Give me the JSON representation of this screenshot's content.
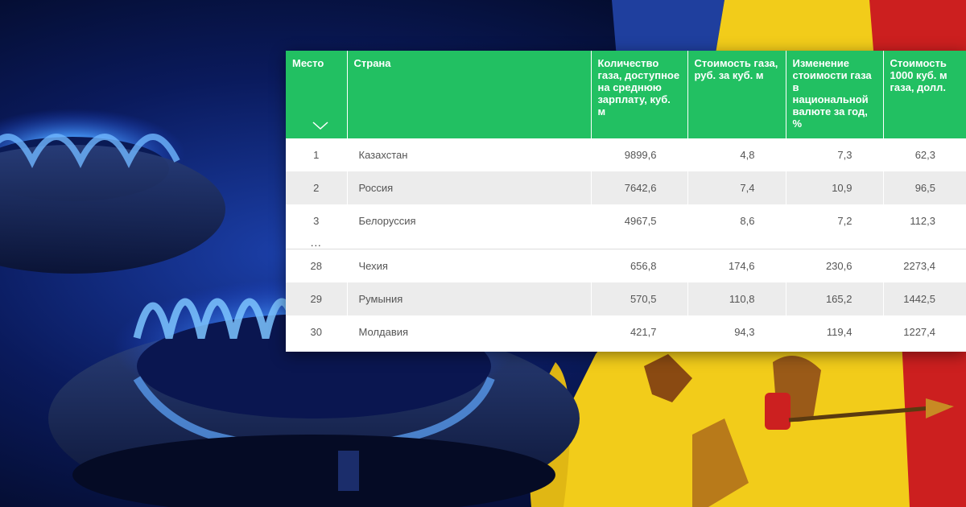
{
  "table": {
    "headers": [
      "Место",
      "Страна",
      "Количество газа, доступное на среднюю зарплату, куб. м",
      "Стоимость газа, руб. за куб. м",
      "Изменение стоимости газа в национальной валюте за год, %",
      "Стоимость 1000 куб. м газа, долл."
    ],
    "sort_icon": "chevron-down-icon",
    "rows_top": [
      {
        "rank": "1",
        "country": "Казахстан",
        "gas": "9899,6",
        "price": "4,8",
        "change": "7,3",
        "usd": "62,3"
      },
      {
        "rank": "2",
        "country": "Россия",
        "gas": "7642,6",
        "price": "7,4",
        "change": "10,9",
        "usd": "96,5"
      },
      {
        "rank": "3",
        "country": "Белоруссия",
        "gas": "4967,5",
        "price": "8,6",
        "change": "7,2",
        "usd": "112,3"
      }
    ],
    "ellipsis": "...",
    "rows_bottom": [
      {
        "rank": "28",
        "country": "Чехия",
        "gas": "656,8",
        "price": "174,6",
        "change": "230,6",
        "usd": "2273,4"
      },
      {
        "rank": "29",
        "country": "Румыния",
        "gas": "570,5",
        "price": "110,8",
        "change": "165,2",
        "usd": "1442,5"
      },
      {
        "rank": "30",
        "country": "Молдавия",
        "gas": "421,7",
        "price": "94,3",
        "change": "119,4",
        "usd": "1227,4"
      }
    ]
  },
  "colors": {
    "header_green": "#22c062",
    "flag_blue": "#1f3f9e",
    "flag_yellow": "#f2cc1a",
    "flag_red": "#cc1f1f",
    "flame_blue": "#2a6cff"
  }
}
